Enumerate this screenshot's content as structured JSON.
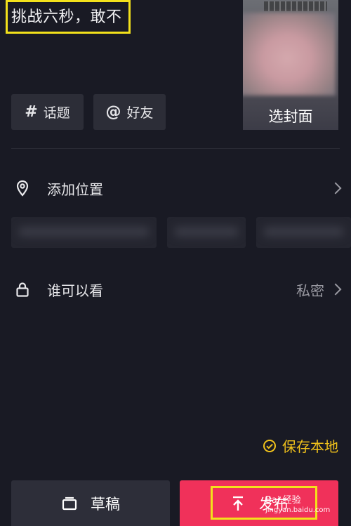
{
  "caption": {
    "text": "挑战六秒，敢不"
  },
  "cover": {
    "label": "选封面"
  },
  "tags": [
    {
      "symbol": "#",
      "label": "话题"
    },
    {
      "symbol": "@",
      "label": "好友"
    }
  ],
  "location": {
    "label": "添加位置",
    "icon": "location-pin-icon"
  },
  "privacy": {
    "label": "谁可以看",
    "value": "私密",
    "icon": "lock-icon"
  },
  "save_local": {
    "label": "保存本地",
    "icon": "check-circle-icon"
  },
  "buttons": {
    "draft": {
      "label": "草稿",
      "icon": "draft-icon"
    },
    "publish": {
      "label": "发布",
      "icon": "publish-icon"
    }
  },
  "watermark": {
    "line1": "Bai 经验",
    "line2": "jingyan.baidu.com"
  },
  "colors": {
    "background": "#191a24",
    "accent": "#f0315a",
    "highlight": "#f3e11b",
    "save": "#f1c21b"
  }
}
